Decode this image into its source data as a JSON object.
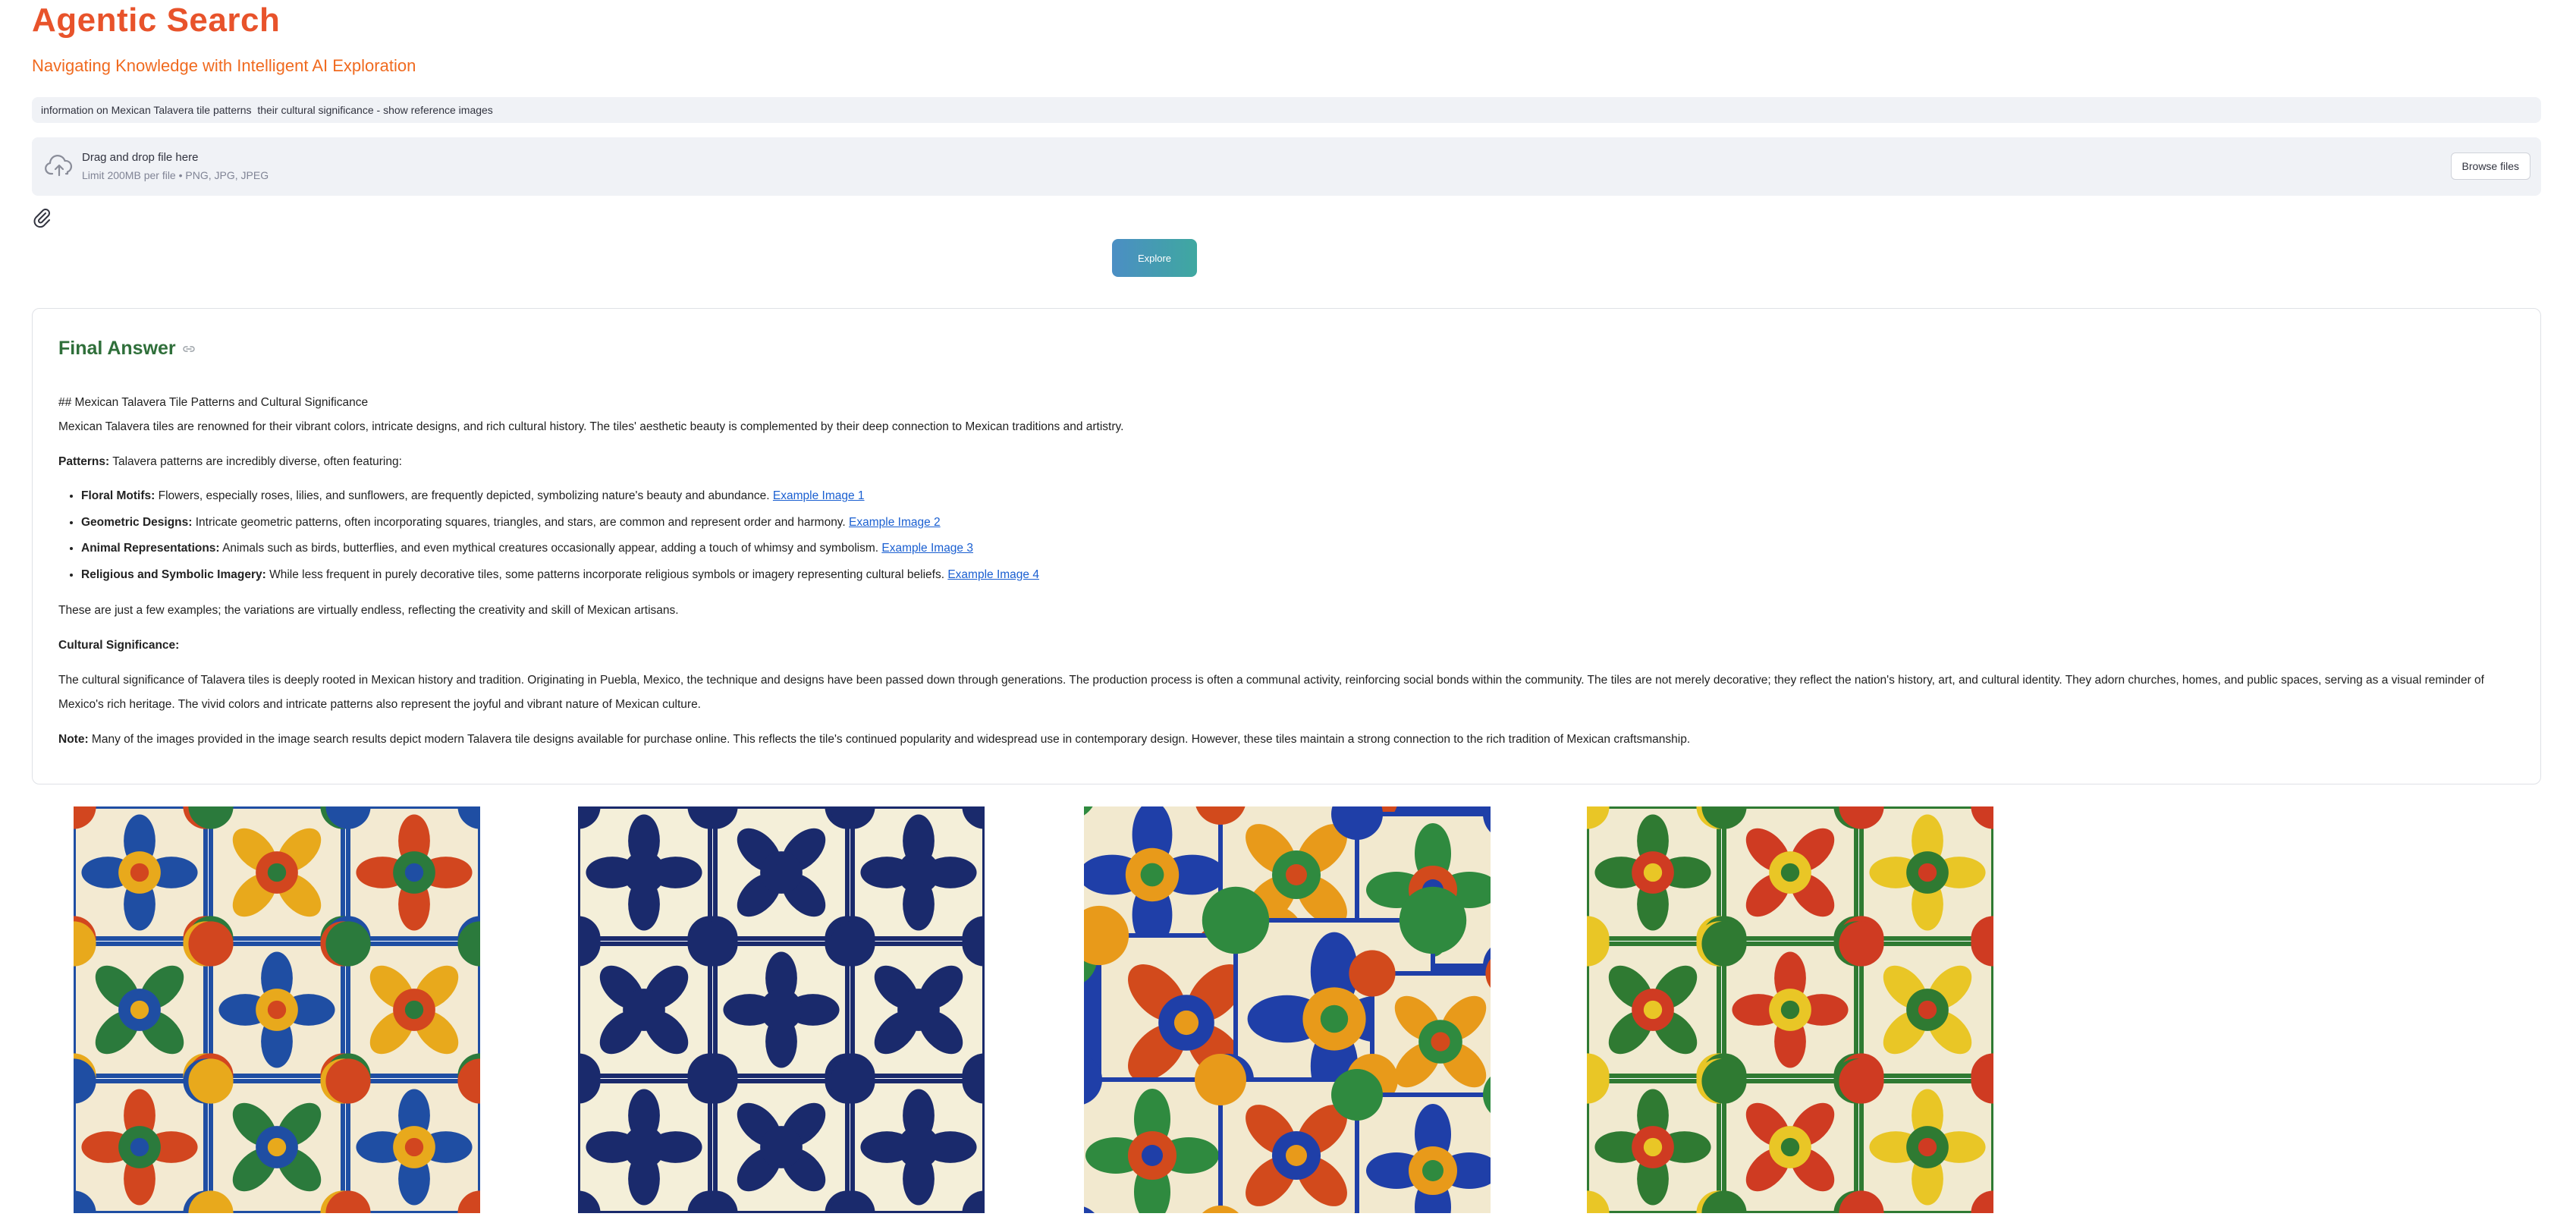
{
  "app": {
    "title": "Agentic Search",
    "subtitle": "Navigating Knowledge with Intelligent AI Exploration"
  },
  "query": {
    "value": "information on Mexican Talavera tile patterns  their cultural significance - show reference images"
  },
  "uploader": {
    "icon": "cloud-upload-icon",
    "primary": "Drag and drop file here",
    "secondary": "Limit 200MB per file • PNG, JPG, JPEG",
    "browse_label": "Browse files"
  },
  "attach": {
    "icon": "paperclip-icon"
  },
  "explore_label": "Explore",
  "answer": {
    "heading": "Final Answer",
    "heading_icon": "link-icon",
    "md_heading": "## Mexican Talavera Tile Patterns and Cultural Significance",
    "intro": "Mexican Talavera tiles are renowned for their vibrant colors, intricate designs, and rich cultural history. The tiles' aesthetic beauty is complemented by their deep connection to Mexican traditions and artistry.",
    "patterns_label": "Patterns:",
    "patterns_text": "Talavera patterns are incredibly diverse, often featuring:",
    "bullets": [
      {
        "label": "Floral Motifs:",
        "text": "Flowers, especially roses, lilies, and sunflowers, are frequently depicted, symbolizing nature's beauty and abundance.",
        "link": "Example Image 1"
      },
      {
        "label": "Geometric Designs:",
        "text": "Intricate geometric patterns, often incorporating squares, triangles, and stars, are common and represent order and harmony.",
        "link": "Example Image 2"
      },
      {
        "label": "Animal Representations:",
        "text": "Animals such as birds, butterflies, and even mythical creatures occasionally appear, adding a touch of whimsy and symbolism.",
        "link": "Example Image 3"
      },
      {
        "label": "Religious and Symbolic Imagery:",
        "text": "While less frequent in purely decorative tiles, some patterns incorporate religious symbols or imagery representing cultural beliefs.",
        "link": "Example Image 4"
      }
    ],
    "variations": "These are just a few examples; the variations are virtually endless, reflecting the creativity and skill of Mexican artisans.",
    "cultural_label": "Cultural Significance:",
    "cultural_text": "The cultural significance of Talavera tiles is deeply rooted in Mexican history and tradition. Originating in Puebla, Mexico, the technique and designs have been passed down through generations. The production process is often a communal activity, reinforcing social bonds within the community. The tiles are not merely decorative; they reflect the nation's history, art, and cultural identity. They adorn churches, homes, and public spaces, serving as a visual reminder of Mexico's rich heritage. The vivid colors and intricate patterns also represent the joyful and vibrant nature of Mexican culture.",
    "note_label": "Note:",
    "note_text": "Many of the images provided in the image search results depict modern Talavera tile designs available for purchase online. This reflects the tile's continued popularity and widespread use in contemporary design. However, these tiles maintain a strong connection to the rich tradition of Mexican craftsmanship."
  },
  "gallery": {
    "images": [
      {
        "name": "talavera-multicolor-grid",
        "colors": [
          "#1f4ea3",
          "#e8a91c",
          "#d2461f",
          "#2b7a3c",
          "#f3ead2"
        ]
      },
      {
        "name": "talavera-blue-white-grid",
        "colors": [
          "#1a2a6c",
          "#f4efd9"
        ]
      },
      {
        "name": "talavera-collage",
        "colors": [
          "#1f3fa8",
          "#e89a1a",
          "#2f8a3f",
          "#d24a1c",
          "#f2e9cf"
        ]
      },
      {
        "name": "talavera-green-red-grid",
        "colors": [
          "#2f7a32",
          "#cf3b22",
          "#e9c626",
          "#f1ead0"
        ]
      }
    ]
  }
}
